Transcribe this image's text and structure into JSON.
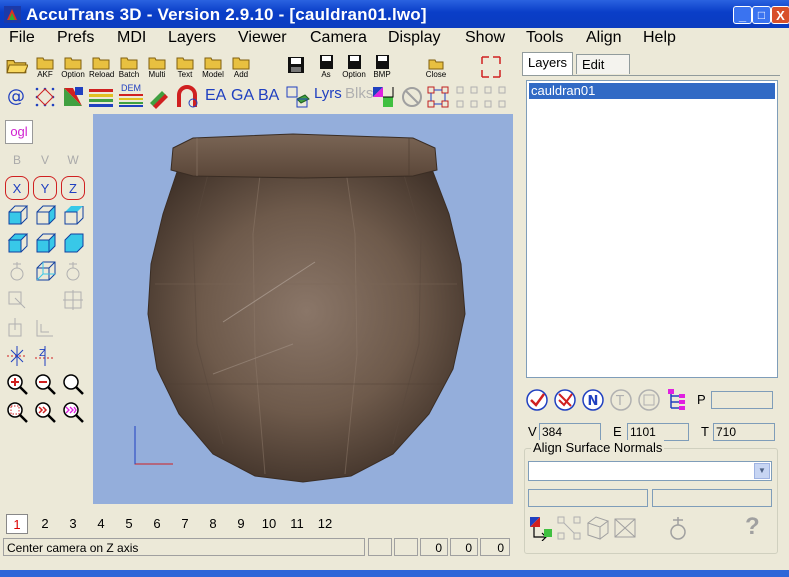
{
  "window": {
    "title": "AccuTrans 3D - Version 2.9.10 - [cauldran01.lwo]",
    "minimize": "_",
    "maximize": "□",
    "close": "X"
  },
  "menu": [
    "File",
    "Prefs",
    "MDI",
    "Layers",
    "Viewer",
    "Camera",
    "Display",
    "Show",
    "Tools",
    "Align",
    "Help"
  ],
  "toolbar": {
    "row1": [
      {
        "name": "open-folder",
        "label": ""
      },
      {
        "name": "akf",
        "label": "AKF"
      },
      {
        "name": "option",
        "label": "Option"
      },
      {
        "name": "reload",
        "label": "Reload"
      },
      {
        "name": "batch",
        "label": "Batch"
      },
      {
        "name": "multi",
        "label": "Multi"
      },
      {
        "name": "text",
        "label": "Text"
      },
      {
        "name": "model",
        "label": "Model"
      },
      {
        "name": "add",
        "label": "Add"
      },
      {
        "name": "save",
        "label": ""
      },
      {
        "name": "save-as",
        "label": "As"
      },
      {
        "name": "save-option",
        "label": "Option"
      },
      {
        "name": "bmp",
        "label": "BMP"
      },
      {
        "name": "close-file",
        "label": "Close"
      }
    ],
    "row2_text": {
      "dem": "DEM",
      "ea": "EA",
      "ga": "GA",
      "ba": "BA",
      "lyrs": "Lyrs",
      "blks": "Blks"
    }
  },
  "sidebar": {
    "ogl": "ogl",
    "b": "B",
    "v": "V",
    "w": "W",
    "x": "X",
    "y": "Y",
    "z": "Z"
  },
  "pages": [
    "1",
    "2",
    "3",
    "4",
    "5",
    "6",
    "7",
    "8",
    "9",
    "10",
    "11",
    "12"
  ],
  "active_page": "1",
  "status": {
    "message": "Center camera on Z axis",
    "cells": [
      "",
      "",
      "0",
      "0",
      "0"
    ]
  },
  "right_panel": {
    "tabs": [
      "Layers",
      "Edit"
    ],
    "active_tab": "Layers",
    "layers": [
      "cauldran01"
    ],
    "p_label": "P",
    "p_value": "",
    "v_label": "V",
    "v_value": "384",
    "e_label": "E",
    "e_value": "1101",
    "t_label": "T",
    "t_value": "710",
    "align_group_title": "Align Surface Normals",
    "align_selected": "",
    "help_glyph": "?"
  },
  "colors": {
    "titlebar": "#0a3ec8",
    "viewport_bg": "#94aedb",
    "selection": "#316ac5",
    "active_page_text": "#dd0000",
    "axis_color": "#d02020"
  }
}
